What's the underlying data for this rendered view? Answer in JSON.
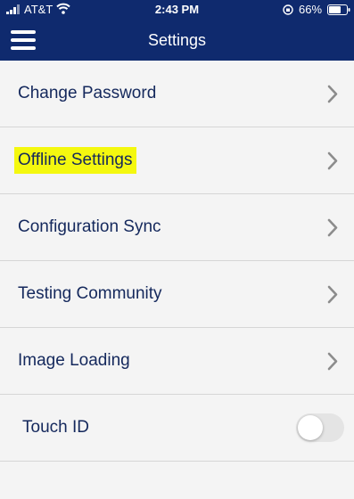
{
  "status_bar": {
    "carrier": "AT&T",
    "time": "2:43 PM",
    "battery_percent": "66%"
  },
  "header": {
    "title": "Settings",
    "background_color": "#0f2a6e"
  },
  "settings": {
    "items": [
      {
        "label": "Change Password"
      },
      {
        "label": "Offline Settings",
        "highlighted": true
      },
      {
        "label": "Configuration Sync"
      },
      {
        "label": "Testing Community"
      },
      {
        "label": "Image Loading"
      }
    ],
    "touch_id": {
      "label": "Touch ID",
      "enabled": false
    }
  },
  "colors": {
    "label": "#14285c",
    "highlight": "#f4f80f"
  }
}
